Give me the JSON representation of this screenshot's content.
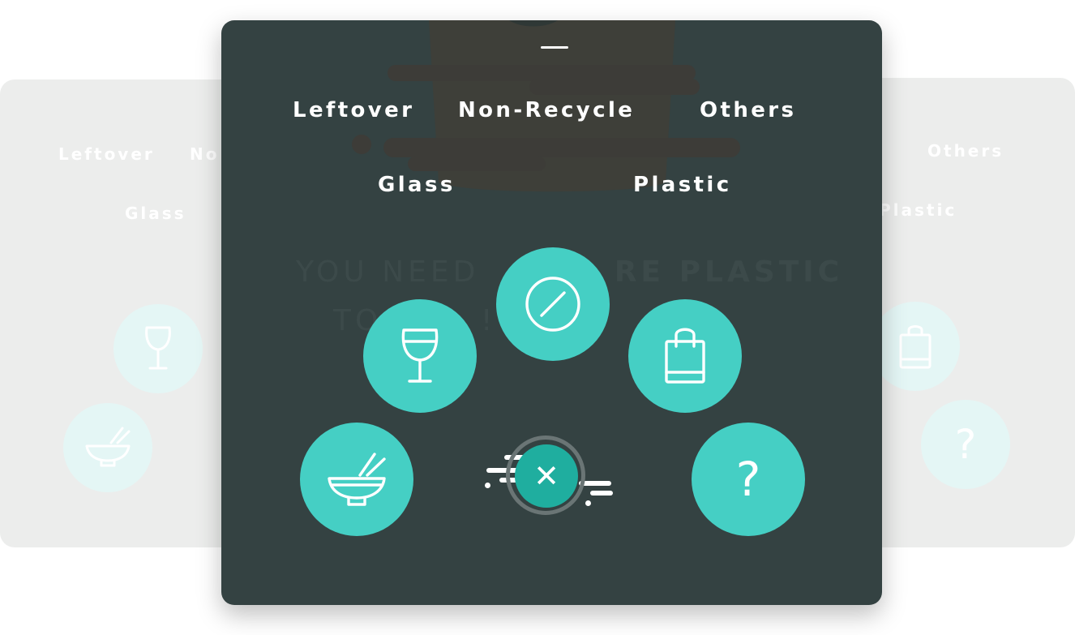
{
  "categories": {
    "leftover": "Leftover",
    "non_recycle": "Non-Recycle",
    "others": "Others",
    "glass": "Glass",
    "plastic": "Plastic"
  },
  "left_card": {
    "leftover": "Leftover",
    "non_recycle_partial": "No",
    "glass": "Glass"
  },
  "right_card": {
    "others": "Others",
    "plastic_partial": "Plastic",
    "question": "?"
  },
  "background_message": {
    "line1_prefix": "YOU NEED ",
    "line1_bold": "RE PLASTIC",
    "line2": "TO            LY       L !"
  },
  "actions": {
    "question_glyph": "?",
    "close_glyph": "✕"
  },
  "icons": [
    "no-entry-icon",
    "wine-glass-icon",
    "shopping-bag-icon",
    "bowl-chopsticks-icon",
    "question-icon",
    "close-icon"
  ],
  "colors": {
    "card_dark": "#344242",
    "teal": "#45cfc4",
    "teal_dark": "#1fae9f",
    "side_card": "#ecedec"
  }
}
